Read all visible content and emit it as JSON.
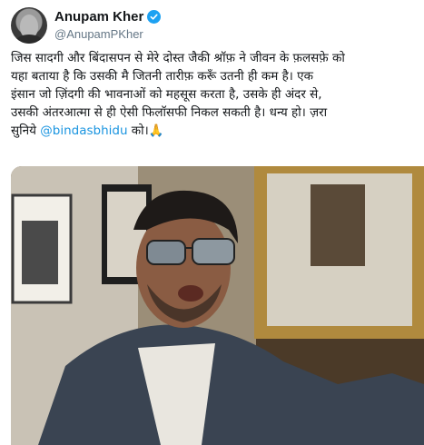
{
  "tweet": {
    "author_name": "Anupam Kher",
    "author_handle": "@AnupamPKher",
    "text_lines": [
      "जिस सादगी और बिंदासपन से मेरे दोस्त जैकी श्रॉफ़ ने जीवन के फ़लसफ़े को",
      "यहा बताया है कि उसकी मै जितनी तारीफ़ करूँ उतनी ही कम है। एक",
      "इंसान जो ज़िंदगी की भावनाओं को महसूस करता है, उसके ही अंदर से,",
      "उसकी अंतरआत्मा से ही ऐसी फिलॉसफी निकल सकती है। धन्य हो। ज़रा"
    ],
    "last_line_prefix": "सुनिये ",
    "mention": "@bindasbhidu",
    "last_line_suffix": " को।",
    "emoji": "🙏"
  },
  "colors": {
    "link": "#1b95e0",
    "verified": "#1da1f2",
    "text": "#14171a",
    "secondary": "#657786"
  },
  "icons": {
    "verified": "verified-badge-icon"
  }
}
